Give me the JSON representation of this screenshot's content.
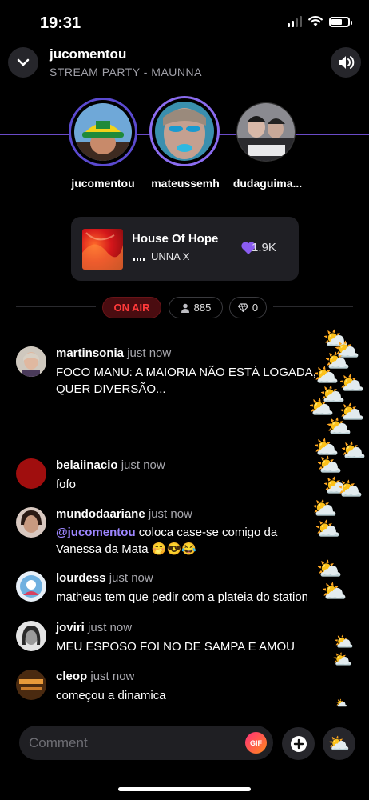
{
  "status_bar": {
    "time": "19:31"
  },
  "header": {
    "title": "jucomentou",
    "subtitle": "STREAM PARTY - MAUNNA"
  },
  "participants": [
    {
      "name": "jucomentou"
    },
    {
      "name": "mateussemh"
    },
    {
      "name": "dudaguima..."
    }
  ],
  "now_playing": {
    "title": "House Of Hope",
    "artist": "UNNA X",
    "likes": "1.9K"
  },
  "stats": {
    "on_air": "ON AIR",
    "viewers": "885",
    "diamonds": "0"
  },
  "comments": [
    {
      "user": "martinsonia",
      "time": "just now",
      "text": "FOCO MANU: A MAIORIA NÃO ESTÁ LOGADA,",
      "text2": "QUER DIVERSÃO..."
    },
    {
      "user": "belaiinacio",
      "time": "just now",
      "text": "fofo"
    },
    {
      "user": "mundodaariane",
      "time": "just now",
      "mention": "@jucomentou",
      "text": " coloca case-se comigo da",
      "text2": "Vanessa da Mata 🤭😎😂"
    },
    {
      "user": "lourdess",
      "time": "just now",
      "text": "matheus tem que pedir com a plateia do station"
    },
    {
      "user": "joviri",
      "time": "just now",
      "text": "MEU ESPOSO FOI NO DE SAMPA E AMOU"
    },
    {
      "user": "cleop",
      "time": "just now",
      "text": "começou a dinamica"
    }
  ],
  "composer": {
    "placeholder": "Comment",
    "gif_label": "GIF",
    "reaction_emoji": "⛅"
  },
  "colors": {
    "accent": "#6a4bc8",
    "on_air_red": "#ff3a3a",
    "mention": "#9d86ff"
  }
}
